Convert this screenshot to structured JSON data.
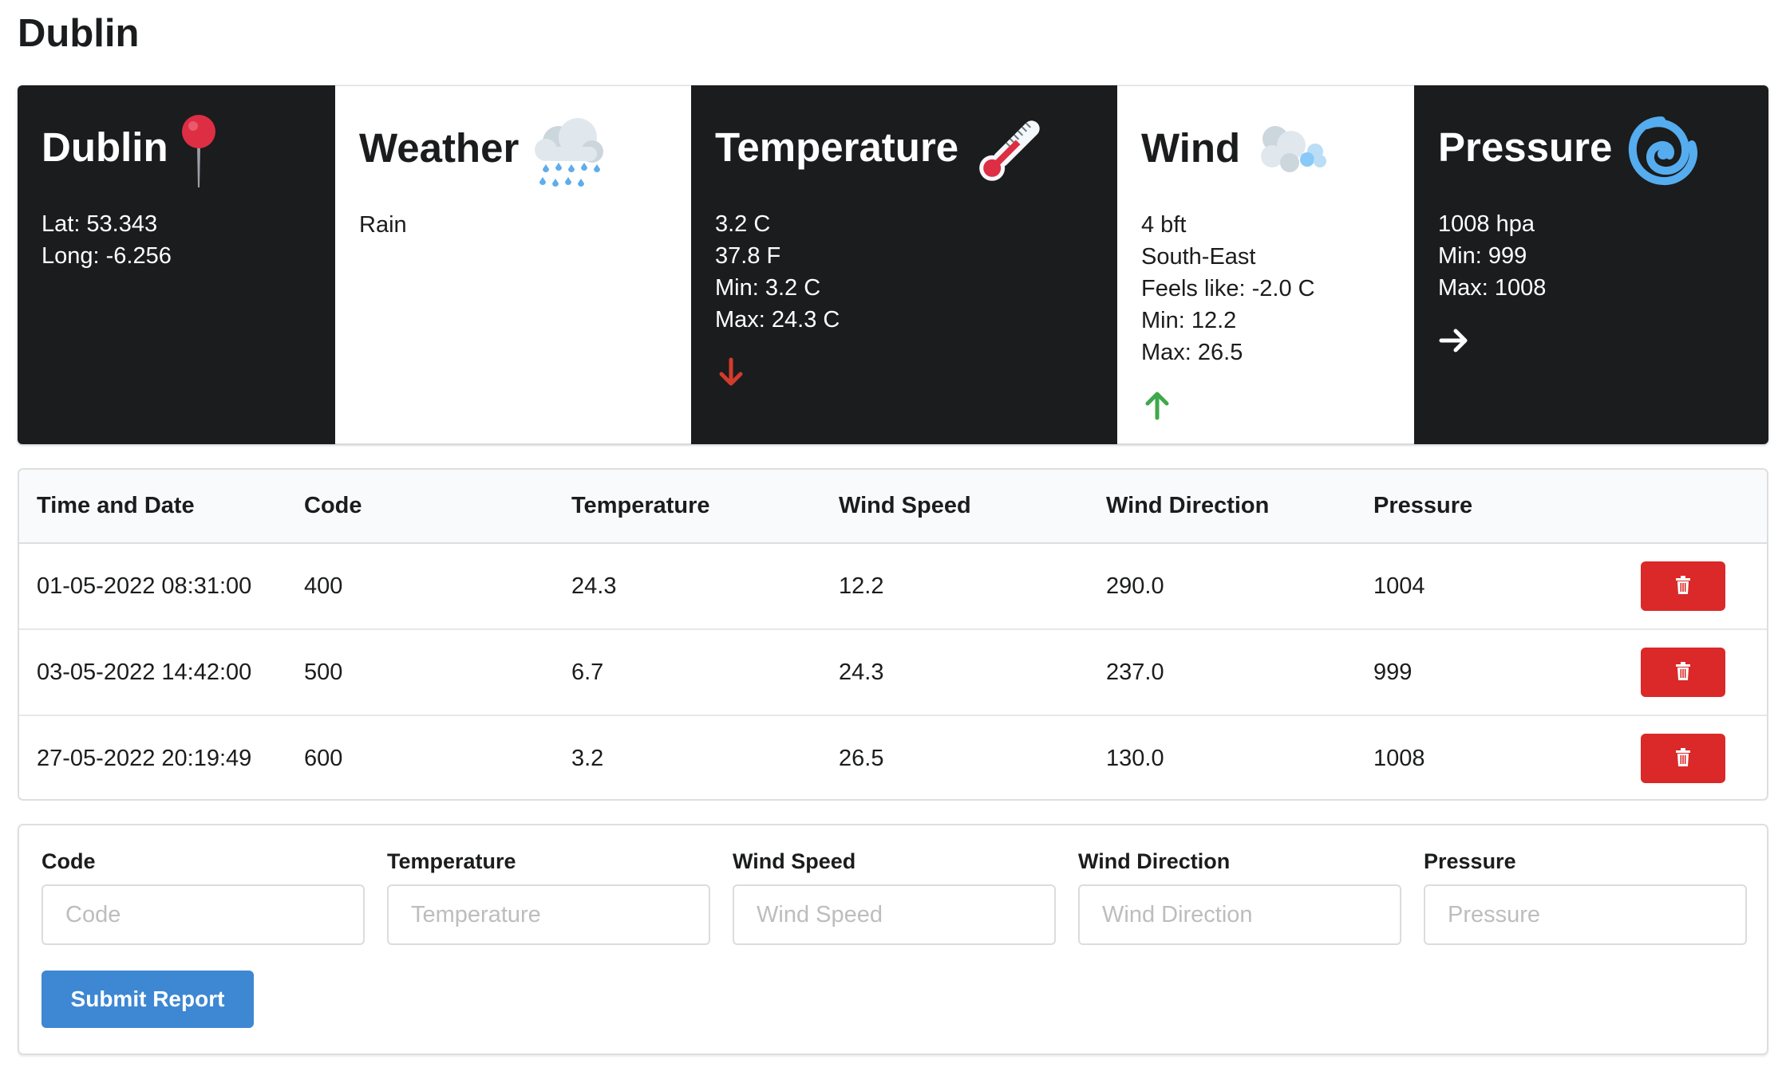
{
  "page": {
    "title": "Dublin"
  },
  "cards": {
    "location": {
      "title": "Dublin",
      "icon": "map-pin-icon",
      "lines": [
        "Lat: 53.343",
        "Long: -6.256"
      ]
    },
    "weather": {
      "title": "Weather",
      "icon": "rain-cloud-icon",
      "lines": [
        "Rain"
      ]
    },
    "temperature": {
      "title": "Temperature",
      "icon": "thermometer-icon",
      "lines": [
        "3.2 C",
        "37.8 F",
        "Min: 3.2 C",
        "Max: 24.3 C"
      ],
      "trend": "down",
      "trend_color": "#d33b2c"
    },
    "wind": {
      "title": "Wind",
      "icon": "wind-icon",
      "lines": [
        "4 bft",
        "South-East",
        "Feels like: -2.0 C",
        "Min: 12.2",
        "Max: 26.5"
      ],
      "trend": "up",
      "trend_color": "#3fa84a"
    },
    "pressure": {
      "title": "Pressure",
      "icon": "cyclone-icon",
      "lines": [
        "1008 hpa",
        "Min: 999",
        "Max: 1008"
      ],
      "trend": "steady",
      "trend_color": "#ffffff"
    }
  },
  "table": {
    "headers": [
      "Time and Date",
      "Code",
      "Temperature",
      "Wind Speed",
      "Wind Direction",
      "Pressure"
    ],
    "rows": [
      [
        "01-05-2022 08:31:00",
        "400",
        "24.3",
        "12.2",
        "290.0",
        "1004"
      ],
      [
        "03-05-2022 14:42:00",
        "500",
        "6.7",
        "24.3",
        "237.0",
        "999"
      ],
      [
        "27-05-2022 20:19:49",
        "600",
        "3.2",
        "26.5",
        "130.0",
        "1008"
      ]
    ],
    "delete_icon": "trash-icon",
    "delete_color": "#db2828"
  },
  "form": {
    "fields": [
      {
        "label": "Code",
        "placeholder": "Code",
        "value": ""
      },
      {
        "label": "Temperature",
        "placeholder": "Temperature",
        "value": ""
      },
      {
        "label": "Wind Speed",
        "placeholder": "Wind Speed",
        "value": ""
      },
      {
        "label": "Wind Direction",
        "placeholder": "Wind Direction",
        "value": ""
      },
      {
        "label": "Pressure",
        "placeholder": "Pressure",
        "value": ""
      }
    ],
    "submit_label": "Submit Report",
    "submit_color": "#3d87d3"
  }
}
